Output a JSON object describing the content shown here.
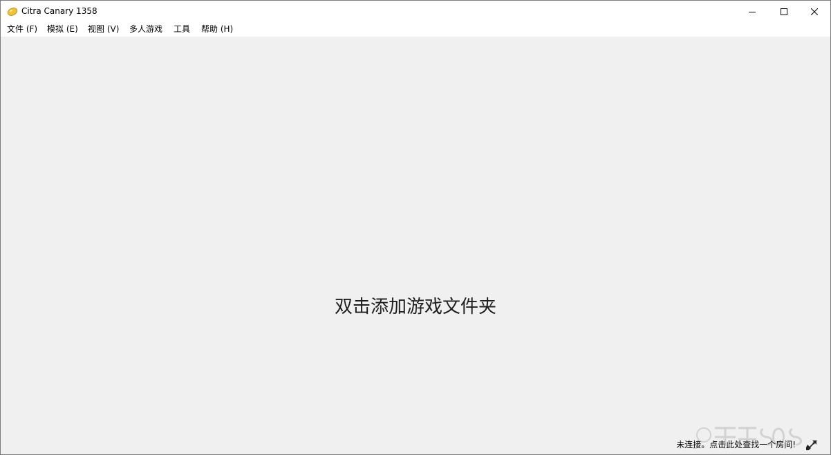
{
  "window": {
    "title": "Citra Canary 1358",
    "app_icon": "citra-lemon-icon",
    "controls": {
      "minimize": "minimize-icon",
      "maximize": "maximize-icon",
      "close": "close-icon"
    }
  },
  "menubar": {
    "items": [
      {
        "label": "文件 (F)"
      },
      {
        "label": "模拟 (E)"
      },
      {
        "label": "视图 (V)"
      },
      {
        "label": "多人游戏"
      },
      {
        "label": "工具"
      },
      {
        "label": "帮助 (H)"
      }
    ]
  },
  "main": {
    "placeholder": "双击添加游戏文件夹"
  },
  "statusbar": {
    "network_status": "未连接。点击此处查找一个房间!",
    "network_icon": "network-disconnected-icon"
  },
  "colors": {
    "titlebar_bg": "#ffffff",
    "content_bg": "#f0f0f0",
    "text": "#000000",
    "icon_yellow": "#f2c232"
  }
}
